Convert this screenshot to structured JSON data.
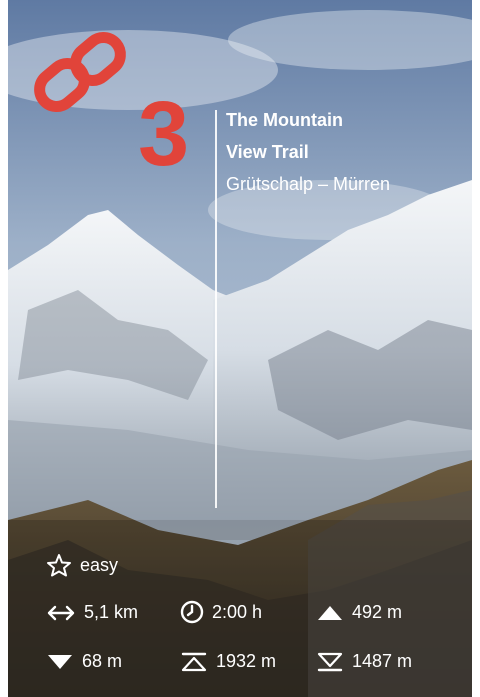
{
  "trail": {
    "number": "3",
    "title_line1": "The Mountain",
    "title_line2": "View Trail",
    "route": "Grütschalp – Mürren"
  },
  "stats": {
    "difficulty": "easy",
    "distance": "5,1 km",
    "duration": "2:00 h",
    "ascent": "492 m",
    "descent": "68 m",
    "highest_point": "1932 m",
    "lowest_point": "1487 m"
  },
  "colors": {
    "accent": "#e1443a",
    "text": "#ffffff"
  },
  "icons": {
    "link": "link-icon",
    "difficulty": "star-outline-icon",
    "distance": "horizontal-arrow-icon",
    "duration": "clock-icon",
    "ascent": "triangle-up-icon",
    "descent": "triangle-down-icon",
    "highest": "summit-icon",
    "lowest": "valley-icon"
  }
}
